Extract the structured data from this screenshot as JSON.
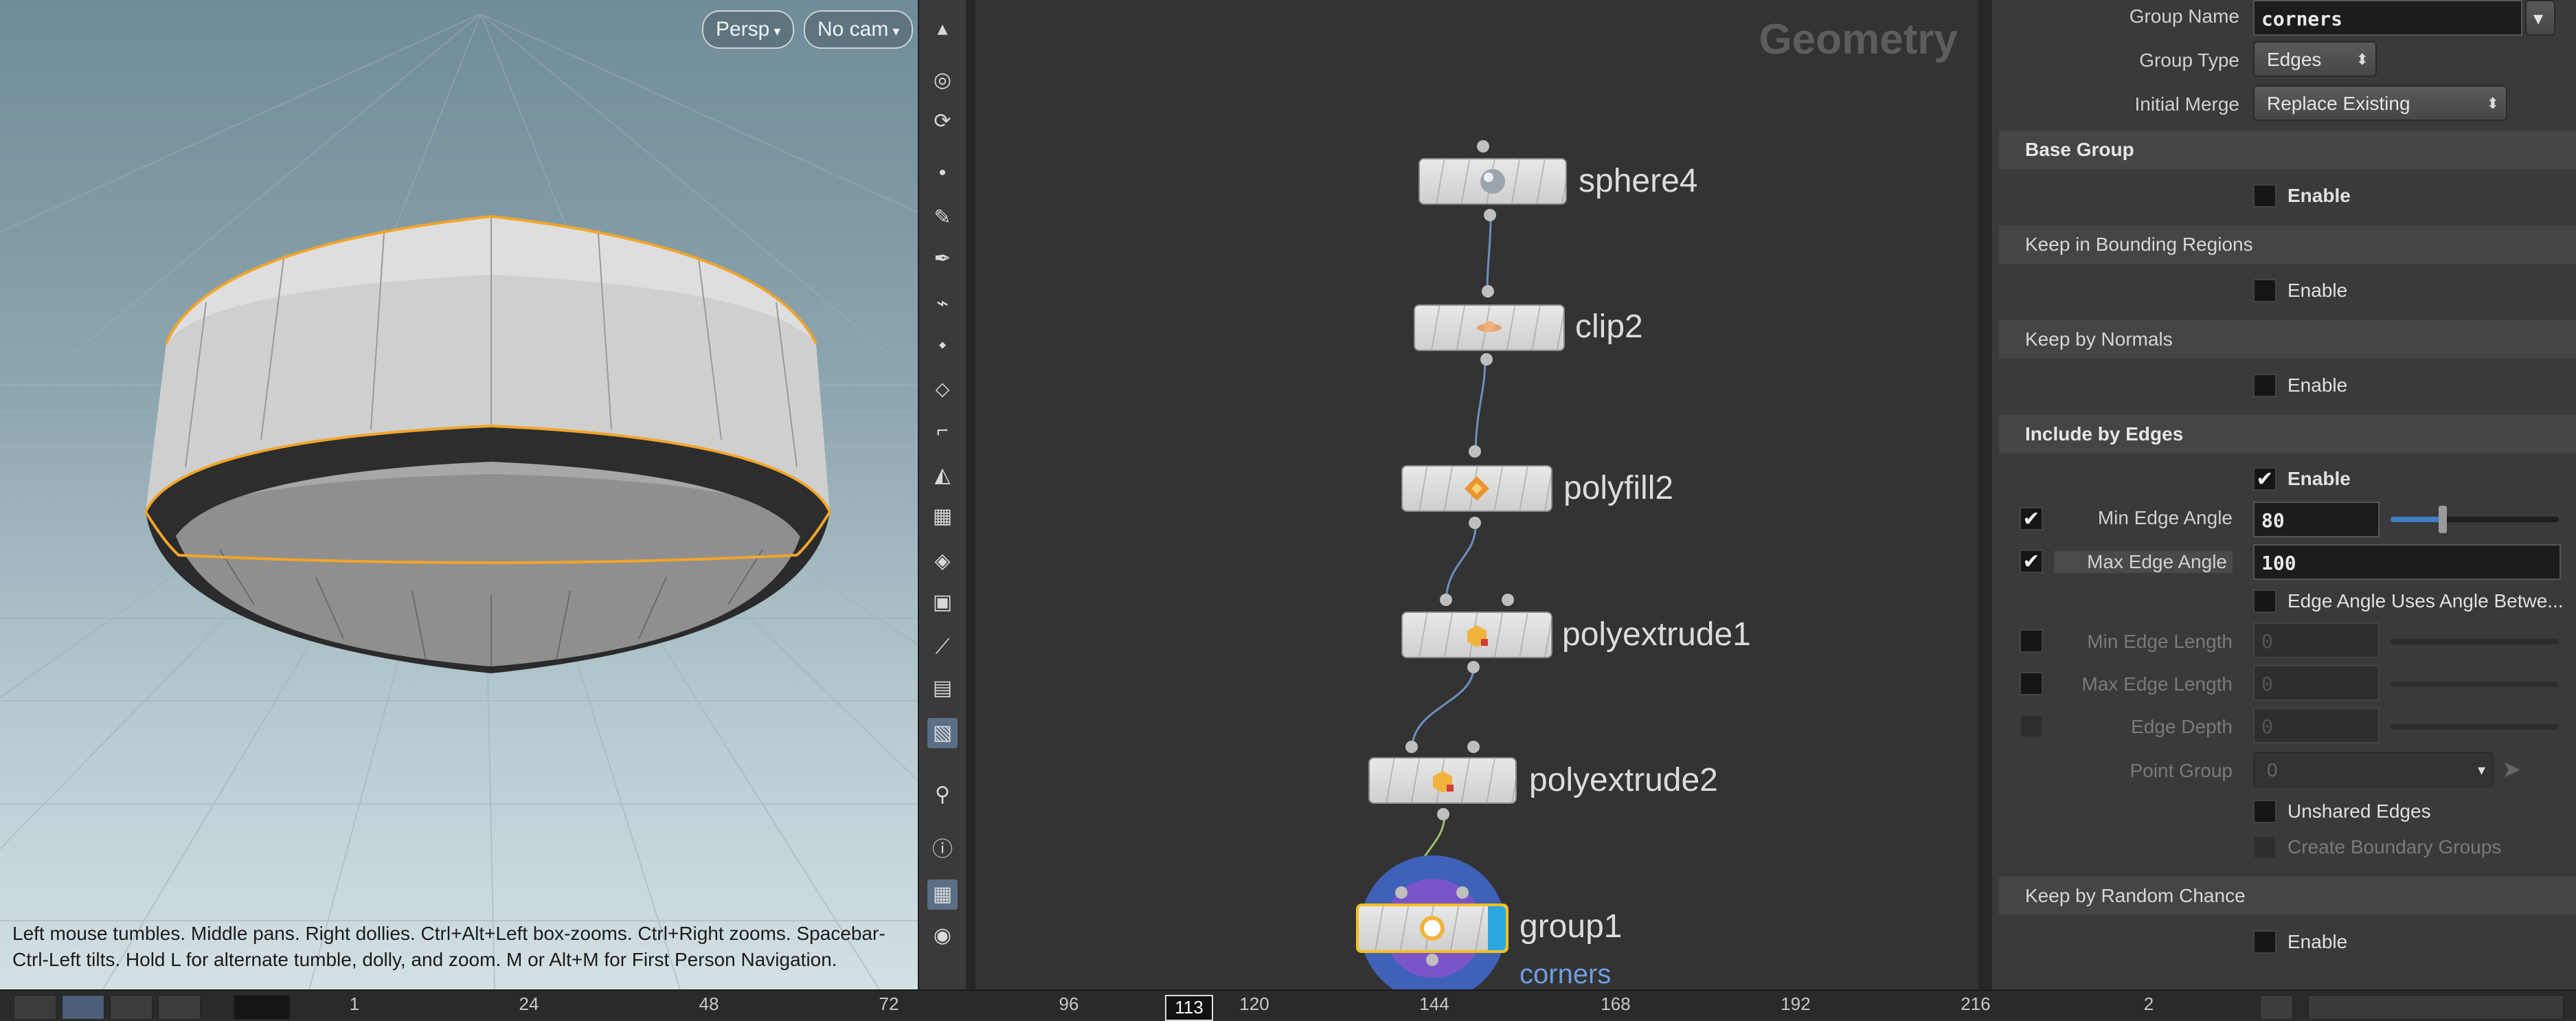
{
  "viewport": {
    "camera_view": "Persp",
    "camera": "No cam",
    "hint_line1": "Left mouse tumbles. Middle pans. Right dollies. Ctrl+Alt+Left box-zooms. Ctrl+Right zooms. Spacebar-",
    "hint_line2": "Ctrl-Left tilts. Hold L for alternate tumble, dolly, and zoom.     M or Alt+M for First Person Navigation."
  },
  "toolbar": {
    "icons": [
      "select-icon",
      "view-icon",
      "tumble-icon",
      "point-icon",
      "brush-icon",
      "pen-icon",
      "snap-icon",
      "edit-icon",
      "handle-icon",
      "corner-icon",
      "light-icon",
      "grid-icon",
      "display-icon",
      "material-icon",
      "bone-icon",
      "layer-icon",
      "background-icon",
      "pin-icon",
      "info-icon",
      "layout-icon",
      "eye-icon"
    ]
  },
  "network": {
    "title": "Geometry",
    "nodes": [
      {
        "name": "sphere4"
      },
      {
        "name": "clip2"
      },
      {
        "name": "polyfill2"
      },
      {
        "name": "polyextrude1"
      },
      {
        "name": "polyextrude2"
      },
      {
        "name": "group1",
        "subtitle": "corners"
      }
    ]
  },
  "params": {
    "group_name_label": "Group Name",
    "group_name_value": "corners",
    "group_type_label": "Group Type",
    "group_type_value": "Edges",
    "initial_merge_label": "Initial Merge",
    "initial_merge_value": "Replace Existing",
    "sections": {
      "base_group": "Base Group",
      "keep_bounding": "Keep in Bounding Regions",
      "keep_normals": "Keep by Normals",
      "include_edges": "Include by Edges",
      "keep_random": "Keep by Random Chance"
    },
    "enable_label": "Enable",
    "min_edge_angle_label": "Min Edge Angle",
    "min_edge_angle_value": "80",
    "max_edge_angle_label": "Max Edge Angle",
    "max_edge_angle_value": "100",
    "edge_angle_uses_label": "Edge Angle Uses Angle Betwe...",
    "min_edge_length_label": "Min Edge Length",
    "min_edge_length_value": "0",
    "max_edge_length_label": "Max Edge Length",
    "max_edge_length_value": "0",
    "edge_depth_label": "Edge Depth",
    "edge_depth_value": "0",
    "point_group_label": "Point Group",
    "point_group_value": "0",
    "unshared_edges_label": "Unshared Edges",
    "create_boundary_label": "Create Boundary Groups",
    "min_edge_angle_slider": 0.31
  },
  "timeline": {
    "ticks": [
      "1",
      "24",
      "48",
      "72",
      "96",
      "120",
      "144",
      "168",
      "192",
      "216",
      "2"
    ],
    "current_frame": "113"
  },
  "colors": {
    "accent_blue": "#3f7fc4",
    "selection_yellow": "#f0c020",
    "edge_highlight": "#f2a52a"
  }
}
